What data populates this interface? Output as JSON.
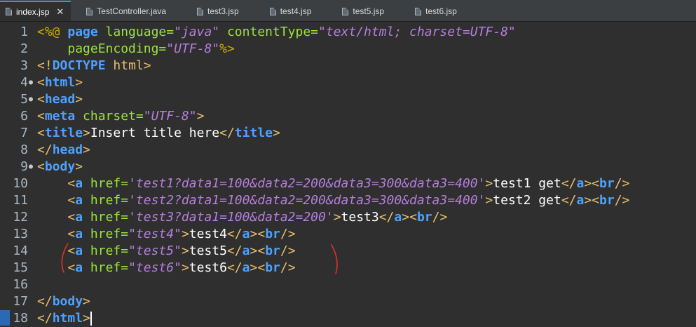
{
  "tabs": [
    {
      "label": "index.jsp",
      "active": true,
      "closable": true
    },
    {
      "label": "TestController.java",
      "active": false
    },
    {
      "label": "test3.jsp",
      "active": false
    },
    {
      "label": "test4.jsp",
      "active": false
    },
    {
      "label": "test5.jsp",
      "active": false
    },
    {
      "label": "test6.jsp",
      "active": false
    }
  ],
  "close_glyph": "✕",
  "fold_glyph": "⊖",
  "lines": [
    {
      "n": "1",
      "fold": false,
      "tokens": [
        [
          "dir",
          "<%@ "
        ],
        [
          "tn",
          "page "
        ],
        [
          "at",
          "language="
        ],
        [
          "av",
          "\"java\" "
        ],
        [
          "at",
          "contentType="
        ],
        [
          "av",
          "\"text/html; charset=UTF-8\""
        ]
      ]
    },
    {
      "n": "2",
      "fold": false,
      "tokens": [
        [
          "t",
          "    "
        ],
        [
          "at",
          "pageEncoding="
        ],
        [
          "av",
          "\"UTF-8\""
        ],
        [
          "dir",
          "%>"
        ]
      ]
    },
    {
      "n": "3",
      "fold": false,
      "tokens": [
        [
          "tg",
          "<!"
        ],
        [
          "tn",
          "DOCTYPE "
        ],
        [
          "tg",
          "html"
        ],
        [
          "tg",
          ">"
        ]
      ]
    },
    {
      "n": "4",
      "fold": true,
      "tokens": [
        [
          "tg",
          "<"
        ],
        [
          "tn",
          "html"
        ],
        [
          "tg",
          ">"
        ]
      ]
    },
    {
      "n": "5",
      "fold": true,
      "tokens": [
        [
          "tg",
          "<"
        ],
        [
          "tn",
          "head"
        ],
        [
          "tg",
          ">"
        ]
      ]
    },
    {
      "n": "6",
      "fold": false,
      "tokens": [
        [
          "tg",
          "<"
        ],
        [
          "tn",
          "meta "
        ],
        [
          "at",
          "charset="
        ],
        [
          "av",
          "\"UTF-8\""
        ],
        [
          "tg",
          ">"
        ]
      ]
    },
    {
      "n": "7",
      "fold": false,
      "tokens": [
        [
          "tg",
          "<"
        ],
        [
          "tn",
          "title"
        ],
        [
          "tg",
          ">"
        ],
        [
          "t",
          "Insert title here"
        ],
        [
          "tg",
          "</"
        ],
        [
          "tn",
          "title"
        ],
        [
          "tg",
          ">"
        ]
      ]
    },
    {
      "n": "8",
      "fold": false,
      "tokens": [
        [
          "tg",
          "</"
        ],
        [
          "tn",
          "head"
        ],
        [
          "tg",
          ">"
        ]
      ]
    },
    {
      "n": "9",
      "fold": true,
      "tokens": [
        [
          "tg",
          "<"
        ],
        [
          "tn",
          "body"
        ],
        [
          "tg",
          ">"
        ]
      ]
    },
    {
      "n": "10",
      "fold": false,
      "tokens": [
        [
          "t",
          "    "
        ],
        [
          "tg",
          "<"
        ],
        [
          "tn",
          "a "
        ],
        [
          "at",
          "href="
        ],
        [
          "av",
          "'test1?data1=100&data2=200&data3=300&data3=400'"
        ],
        [
          "tg",
          ">"
        ],
        [
          "t",
          "test1 get"
        ],
        [
          "tg",
          "</"
        ],
        [
          "tn",
          "a"
        ],
        [
          "tg",
          "><"
        ],
        [
          "tn",
          "br"
        ],
        [
          "tg",
          "/>"
        ]
      ]
    },
    {
      "n": "11",
      "fold": false,
      "tokens": [
        [
          "t",
          "    "
        ],
        [
          "tg",
          "<"
        ],
        [
          "tn",
          "a "
        ],
        [
          "at",
          "href="
        ],
        [
          "av",
          "'test2?data1=100&data2=200&data3=300&data3=400'"
        ],
        [
          "tg",
          ">"
        ],
        [
          "t",
          "test2 get"
        ],
        [
          "tg",
          "</"
        ],
        [
          "tn",
          "a"
        ],
        [
          "tg",
          "><"
        ],
        [
          "tn",
          "br"
        ],
        [
          "tg",
          "/>"
        ]
      ]
    },
    {
      "n": "12",
      "fold": false,
      "tokens": [
        [
          "t",
          "    "
        ],
        [
          "tg",
          "<"
        ],
        [
          "tn",
          "a "
        ],
        [
          "at",
          "href="
        ],
        [
          "av",
          "'test3?data1=100&data2=200'"
        ],
        [
          "tg",
          ">"
        ],
        [
          "t",
          "test3"
        ],
        [
          "tg",
          "</"
        ],
        [
          "tn",
          "a"
        ],
        [
          "tg",
          "><"
        ],
        [
          "tn",
          "br"
        ],
        [
          "tg",
          "/>"
        ]
      ]
    },
    {
      "n": "13",
      "fold": false,
      "tokens": [
        [
          "t",
          "    "
        ],
        [
          "tg",
          "<"
        ],
        [
          "tn",
          "a "
        ],
        [
          "at",
          "href="
        ],
        [
          "av",
          "\"test4\""
        ],
        [
          "tg",
          ">"
        ],
        [
          "t",
          "test4"
        ],
        [
          "tg",
          "</"
        ],
        [
          "tn",
          "a"
        ],
        [
          "tg",
          "><"
        ],
        [
          "tn",
          "br"
        ],
        [
          "tg",
          "/>"
        ]
      ]
    },
    {
      "n": "14",
      "fold": false,
      "tokens": [
        [
          "t",
          "    "
        ],
        [
          "tg",
          "<"
        ],
        [
          "tn",
          "a "
        ],
        [
          "at",
          "href="
        ],
        [
          "av",
          "\"test5\""
        ],
        [
          "tg",
          ">"
        ],
        [
          "t",
          "test5"
        ],
        [
          "tg",
          "</"
        ],
        [
          "tn",
          "a"
        ],
        [
          "tg",
          "><"
        ],
        [
          "tn",
          "br"
        ],
        [
          "tg",
          "/>"
        ]
      ]
    },
    {
      "n": "15",
      "fold": false,
      "tokens": [
        [
          "t",
          "    "
        ],
        [
          "tg",
          "<"
        ],
        [
          "tn",
          "a "
        ],
        [
          "at",
          "href="
        ],
        [
          "av",
          "\"test6\""
        ],
        [
          "tg",
          ">"
        ],
        [
          "t",
          "test6"
        ],
        [
          "tg",
          "</"
        ],
        [
          "tn",
          "a"
        ],
        [
          "tg",
          "><"
        ],
        [
          "tn",
          "br"
        ],
        [
          "tg",
          "/>"
        ]
      ]
    },
    {
      "n": "16",
      "fold": false,
      "tokens": []
    },
    {
      "n": "17",
      "fold": false,
      "tokens": [
        [
          "tg",
          "</"
        ],
        [
          "tn",
          "body"
        ],
        [
          "tg",
          ">"
        ]
      ]
    },
    {
      "n": "18",
      "fold": false,
      "current": true,
      "tokens": [
        [
          "tg",
          "</"
        ],
        [
          "tn",
          "html"
        ],
        [
          "tg",
          ">"
        ]
      ]
    }
  ],
  "colors": {
    "annotation": "#e0302a",
    "current_line_marker": "#2b6ab3"
  }
}
